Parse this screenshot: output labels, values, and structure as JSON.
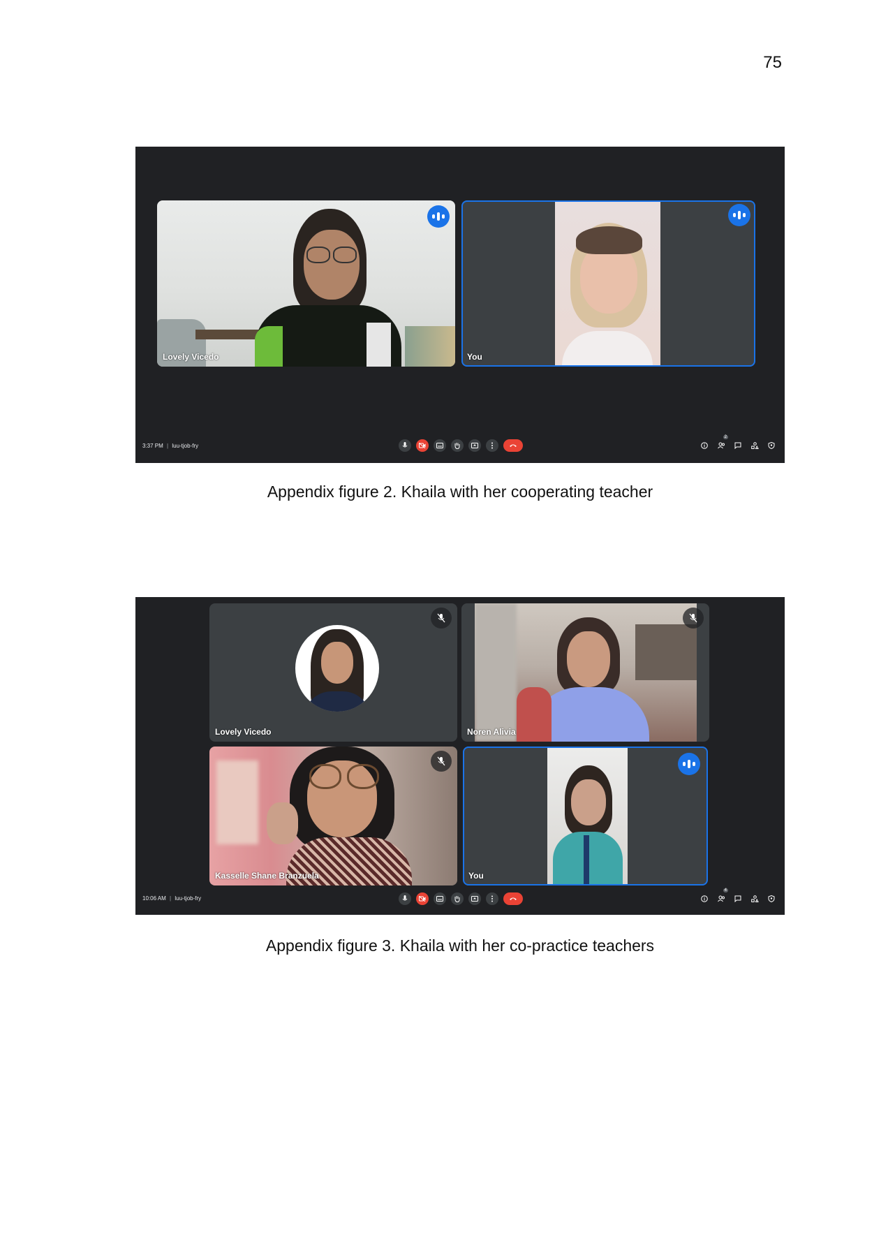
{
  "page": {
    "number": "75"
  },
  "figure2": {
    "caption": "Appendix figure 2. Khaila with her cooperating teacher",
    "meeting": {
      "time": "3:37 PM",
      "separator": "|",
      "code": "luu-tjob-fry",
      "participants_count": "2",
      "tiles": [
        {
          "name": "Lovely Vicedo",
          "speaking": true
        },
        {
          "name": "You",
          "speaking": true,
          "active": true
        }
      ]
    }
  },
  "figure3": {
    "caption": "Appendix figure 3. Khaila with her co-practice teachers",
    "meeting": {
      "time": "10:06 AM",
      "separator": "|",
      "code": "luu-tjob-fry",
      "participants_count": "4",
      "tiles": [
        {
          "name": "Lovely Vicedo",
          "muted": true
        },
        {
          "name": "Noren Alivia",
          "muted": true
        },
        {
          "name": "Kasselle Shane Branzuela",
          "muted": true
        },
        {
          "name": "You",
          "speaking": true,
          "active": true
        }
      ]
    }
  },
  "colors": {
    "meet_bg": "#202124",
    "tile_bg": "#3c4043",
    "accent": "#1a73e8",
    "danger": "#ea4335"
  },
  "icons": [
    "mic-icon",
    "camera-off-icon",
    "captions-icon",
    "raise-hand-icon",
    "present-icon",
    "more-options-icon",
    "end-call-icon",
    "info-icon",
    "people-icon",
    "chat-icon",
    "activities-icon",
    "host-controls-icon",
    "speaking-indicator-icon",
    "mic-off-icon"
  ]
}
